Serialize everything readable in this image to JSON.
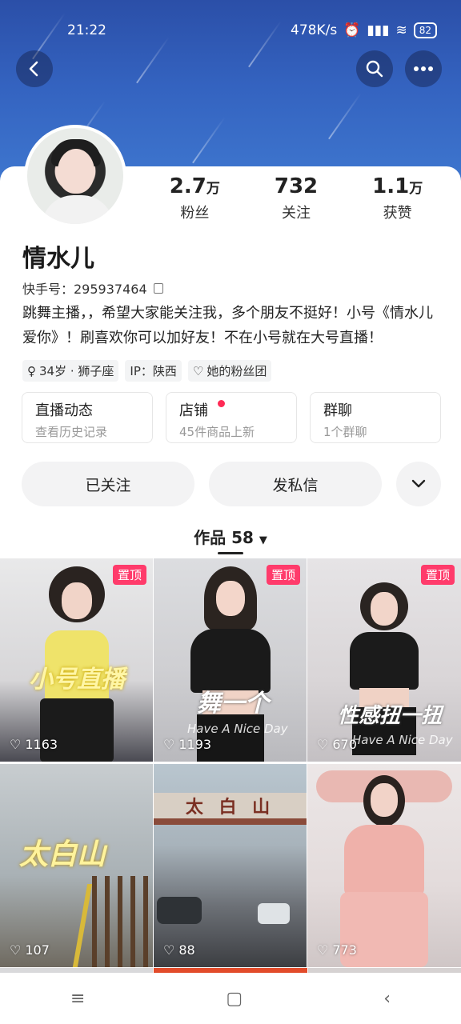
{
  "status_bar": {
    "time": "21:22",
    "speed": "478K/s",
    "battery": "82"
  },
  "profile": {
    "name": "情水儿",
    "kuaishou_id": "快手号：295937464",
    "bio": "跳舞主播，，希望大家能关注我，多个朋友不挺好！小号《情水儿爱你》！刷喜欢你可以加好友！不在小号就在大号直播！",
    "stats": [
      {
        "value": "2.7",
        "unit": "万",
        "label": "粉丝"
      },
      {
        "value": "732",
        "unit": "",
        "label": "关注"
      },
      {
        "value": "1.1",
        "unit": "万",
        "label": "获赞"
      }
    ],
    "tags": [
      "34岁 · 狮子座",
      "IP：陕西",
      "她的粉丝团"
    ]
  },
  "entries": [
    {
      "title": "直播动态",
      "sub": "查看历史记录"
    },
    {
      "title": "店铺",
      "sub": "45件商品上新"
    },
    {
      "title": "群聊",
      "sub": "1个群聊"
    }
  ],
  "actions": {
    "follow": "已关注",
    "message": "发私信"
  },
  "tabs": {
    "works": "作品 58"
  },
  "pin_label": "置顶",
  "videos": [
    {
      "likes": "1163",
      "caption": "小号直播",
      "subcap": "",
      "pinned": true
    },
    {
      "likes": "1193",
      "caption": "舞一个",
      "subcap": "Have A Nice Day",
      "pinned": true
    },
    {
      "likes": "670",
      "caption": "性感扭一扭",
      "subcap": "Have A Nice Day",
      "pinned": true
    },
    {
      "likes": "107",
      "caption": "太白山",
      "subcap": "",
      "pinned": false
    },
    {
      "likes": "88",
      "caption": "",
      "subcap": "",
      "pinned": false,
      "sign": "太 白 山"
    },
    {
      "likes": "773",
      "caption": "",
      "subcap": "",
      "pinned": false
    }
  ],
  "colors": {
    "accent": "#ff3b6b",
    "header_blue": "#3463c0"
  },
  "icons": [
    "back-icon",
    "search-icon",
    "more-icon",
    "copy-icon",
    "heart-icon",
    "chevron-down-icon",
    "menu-icon",
    "home-icon",
    "back-nav-icon"
  ]
}
